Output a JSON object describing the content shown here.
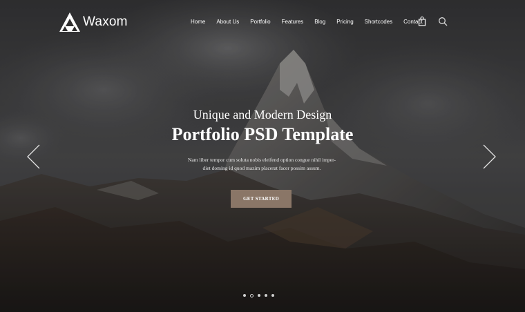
{
  "brand": {
    "name": "Waxom"
  },
  "nav": {
    "items": [
      {
        "label": "Home"
      },
      {
        "label": "About Us"
      },
      {
        "label": "Portfolio"
      },
      {
        "label": "Features"
      },
      {
        "label": "Blog"
      },
      {
        "label": "Pricing"
      },
      {
        "label": "Shortcodes"
      },
      {
        "label": "Contact"
      }
    ],
    "icons": [
      "shopping-bag-icon",
      "search-icon"
    ]
  },
  "hero": {
    "subtitle": "Unique and Modern Design",
    "title": "Portfolio PSD Template",
    "description_line1": "Nam liber tempor cum soluta nobis eleifend option congue nihil imper-",
    "description_line2": "diet doming id quod mazim placerat facer possim assum.",
    "cta_label": "GET STARTED"
  },
  "slider": {
    "slide_count": 5,
    "active_index": 1
  },
  "colors": {
    "accent": "#8a7667",
    "text": "#ffffff"
  }
}
